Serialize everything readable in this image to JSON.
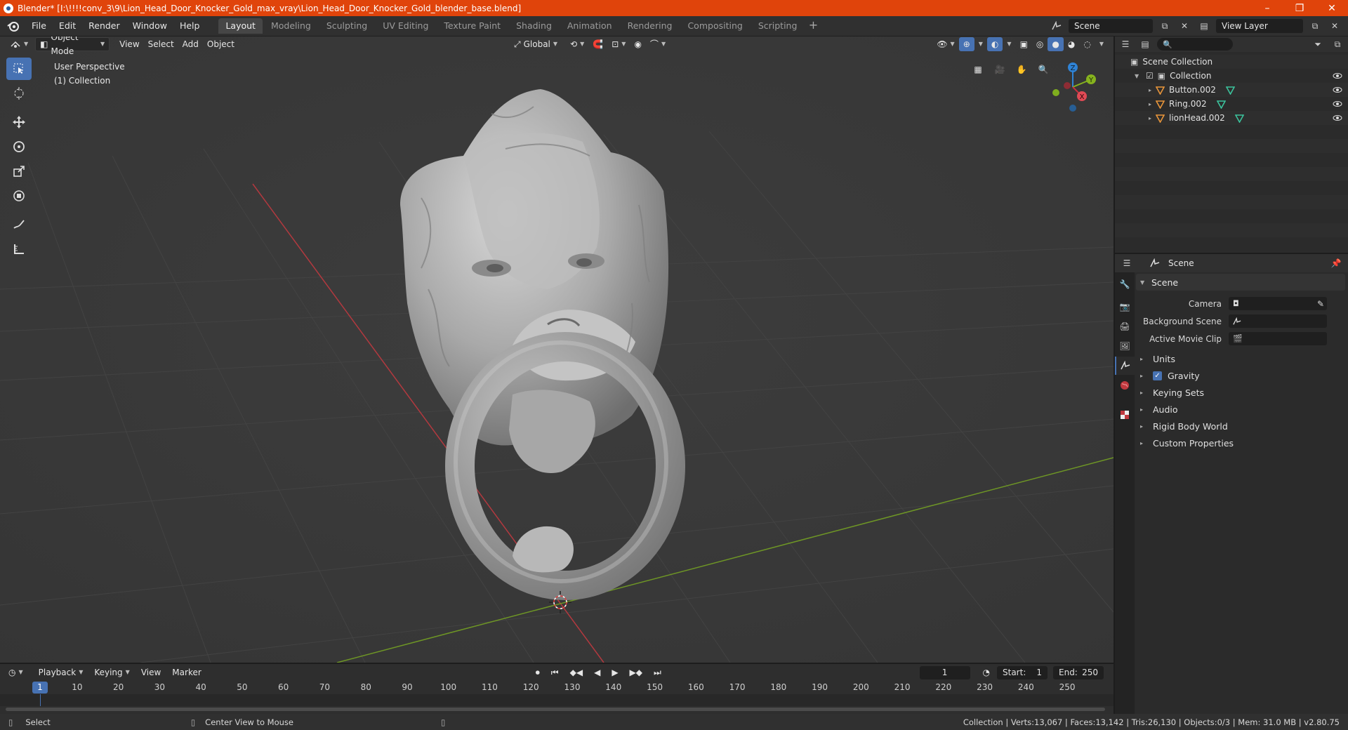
{
  "window": {
    "title": "Blender* [I:\\!!!!conv_3\\9\\Lion_Head_Door_Knocker_Gold_max_vray\\Lion_Head_Door_Knocker_Gold_blender_base.blend]",
    "controls": [
      "–",
      "❐",
      "✕"
    ]
  },
  "menu": {
    "items": [
      "File",
      "Edit",
      "Render",
      "Window",
      "Help"
    ],
    "workspaces": [
      "Layout",
      "Modeling",
      "Sculpting",
      "UV Editing",
      "Texture Paint",
      "Shading",
      "Animation",
      "Rendering",
      "Compositing",
      "Scripting"
    ],
    "active_workspace": "Layout",
    "scene": "Scene",
    "view_layer": "View Layer"
  },
  "viewport": {
    "mode": "Object Mode",
    "menus": [
      "View",
      "Select",
      "Add",
      "Object"
    ],
    "orientation": "Global",
    "perspective": "User Perspective",
    "collection": "(1) Collection",
    "gizmo": {
      "x": "X",
      "y": "Y",
      "z": "Z"
    }
  },
  "outliner": {
    "root": "Scene Collection",
    "collection": "Collection",
    "objects": [
      "Button.002",
      "Ring.002",
      "lionHead.002"
    ]
  },
  "properties": {
    "context": "Scene",
    "panel": "Scene",
    "fields": [
      {
        "label": "Camera",
        "value": ""
      },
      {
        "label": "Background Scene",
        "value": ""
      },
      {
        "label": "Active Movie Clip",
        "value": ""
      }
    ],
    "subpanels": [
      "Units",
      "Gravity",
      "Keying Sets",
      "Audio",
      "Rigid Body World",
      "Custom Properties"
    ]
  },
  "timeline": {
    "menus": [
      "Playback",
      "Keying",
      "View",
      "Marker"
    ],
    "current_frame": "1",
    "start_label": "Start:",
    "start": "1",
    "end_label": "End:",
    "end": "250",
    "ticks": [
      "10",
      "20",
      "30",
      "40",
      "50",
      "60",
      "70",
      "80",
      "90",
      "100",
      "110",
      "120",
      "130",
      "140",
      "150",
      "160",
      "170",
      "180",
      "190",
      "200",
      "210",
      "220",
      "230",
      "240",
      "250"
    ]
  },
  "status": {
    "left": "Select",
    "middle": "Center View to Mouse",
    "right": "Collection | Verts:13,067 | Faces:13,142 | Tris:26,130 | Objects:0/3 | Mem: 31.0 MB | v2.80.75"
  },
  "colors": {
    "titlebar": "#e0440b",
    "accent": "#4772b3",
    "x_axis": "#c9303f",
    "y_axis": "#86b21e",
    "z_axis": "#2f83d6"
  }
}
